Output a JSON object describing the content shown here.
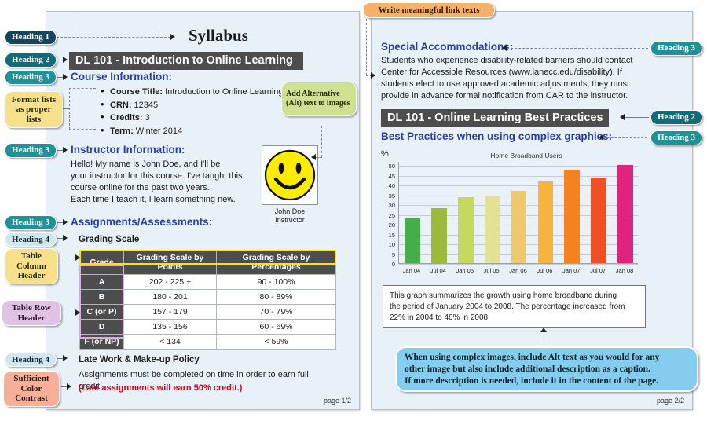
{
  "pages": {
    "left": {
      "page_number": "page 1/2"
    },
    "right": {
      "page_number": "page 2/2"
    }
  },
  "left_page": {
    "h1": "Syllabus",
    "h2_bar": "DL 101 - Introduction to Online Learning",
    "course_info_heading": "Course Information:",
    "course_info_items": [
      {
        "label": "Course Title:",
        "value": " Introduction to Online Learning"
      },
      {
        "label": "CRN:",
        "value": " 12345"
      },
      {
        "label": "Credits:",
        "value": " 3"
      },
      {
        "label": "Term:",
        "value": " Winter 2014"
      }
    ],
    "instructor_heading": "Instructor Information:",
    "instructor_body_lines": [
      "Hello! My name is John Doe, and I'll be",
      "your instructor for this course. I've taught this",
      "course online for the past two years.",
      "Each time I teach it, I learn something new."
    ],
    "photo_caption_line1": "John Doe",
    "photo_caption_line2": "Instructor",
    "assignments_heading": "Assignments/Assessments:",
    "grading_scale_heading": "Grading Scale",
    "grade_table": {
      "columns": [
        "Grade",
        "Grading Scale by Points",
        "Grading Scale by Percentages"
      ],
      "rows": [
        {
          "grade": "A",
          "points": "202 - 225 +",
          "percent": "90 - 100%"
        },
        {
          "grade": "B",
          "points": "180 - 201",
          "percent": "80 - 89%"
        },
        {
          "grade": "C (or P)",
          "points": "157 - 179",
          "percent": "70 - 79%"
        },
        {
          "grade": "D",
          "points": "135 - 156",
          "percent": "60 - 69%"
        },
        {
          "grade": "F (or NP)",
          "points": "< 134",
          "percent": "< 59%"
        }
      ]
    },
    "late_policy_heading": "Late Work & Make-up Policy",
    "late_policy_body": "Assignments must be completed on time in order to earn full credit.",
    "late_policy_red": "(Late assignments will earn 50% credit.)"
  },
  "right_page": {
    "special_heading": "Special Accommodations:",
    "special_body_lines": [
      "Students who experience disability-related barriers should contact",
      "Center for Accessible Resources (www.lanecc.edu/disability). If",
      "students elect to use approved academic adjustments, they must",
      "provide in advance formal notification from CAR to the instructor."
    ],
    "h2_bar": "DL 101 - Online Learning Best Practices",
    "best_practices_heading": "Best Practices when using complex graphics:",
    "chart_caption_lines": [
      "This graph summarizes the growth using home broadband during",
      "the period of January 2004 to 2008. The percentage increased from",
      "22% in 2004 to 48%  in 2008."
    ]
  },
  "chart_data": {
    "type": "bar",
    "title": "Home Broadband Users",
    "xlabel": "",
    "ylabel": "%",
    "ylim": [
      0,
      52
    ],
    "yticks": [
      0,
      5,
      10,
      15,
      20,
      25,
      30,
      35,
      40,
      45,
      50
    ],
    "grid": true,
    "legend": "none",
    "categories": [
      "Jan 04",
      "Jul 04",
      "Jan 05",
      "Jul 05",
      "Jan 06",
      "Jul 06",
      "Jan 07",
      "Jul 07",
      "Jan 08"
    ],
    "values": [
      23,
      28,
      33.5,
      34.5,
      37,
      41.5,
      47.5,
      43.5,
      50
    ],
    "colors": [
      "#44ae49",
      "#9bbb3a",
      "#c3d65b",
      "#e2e08f",
      "#ecc96a",
      "#f6b councillors"
    ]
  },
  "chart_bar_colors": [
    "#44ae49",
    "#9cbb3c",
    "#c5d95e",
    "#e3e193",
    "#eec96c",
    "#f8b33d",
    "#f5821f",
    "#f04e23",
    "#e0247e"
  ],
  "callouts": {
    "heading1": "Heading 1",
    "heading2": "Heading 2",
    "heading3": "Heading 3",
    "heading4": "Heading 4",
    "format_lists": "Format lists as proper lists",
    "table_column_header": "Table Column Header",
    "table_row_header": "Table Row Header",
    "sufficient_color_contrast": "Sufficient Color Contrast",
    "add_alt_text": "Add Alternative (Alt) text to images",
    "write_meaningful_links": "Write meaningful link texts",
    "complex_images_note_lines": [
      "When using complex images, include Alt text as you would for any",
      "other image but also include additional description as a caption.",
      "If more description is needed, include it in the content of the page."
    ]
  },
  "colors": {
    "page_bg": "#e9f1f8",
    "heading_bar": "#4d4d4d",
    "h3_blue": "#2a3f9e",
    "red": "#cc0018",
    "pill_h1": "#16445c",
    "pill_h2": "#126b75",
    "pill_h3": "#1f9299",
    "pill_h4": "#cfe7f2",
    "yellow": "#f6e08a",
    "purple": "#e0c2e4",
    "salmon": "#f6b09a",
    "green": "#cfe093",
    "orange": "#f5b069",
    "lightblue": "#84cdee"
  }
}
